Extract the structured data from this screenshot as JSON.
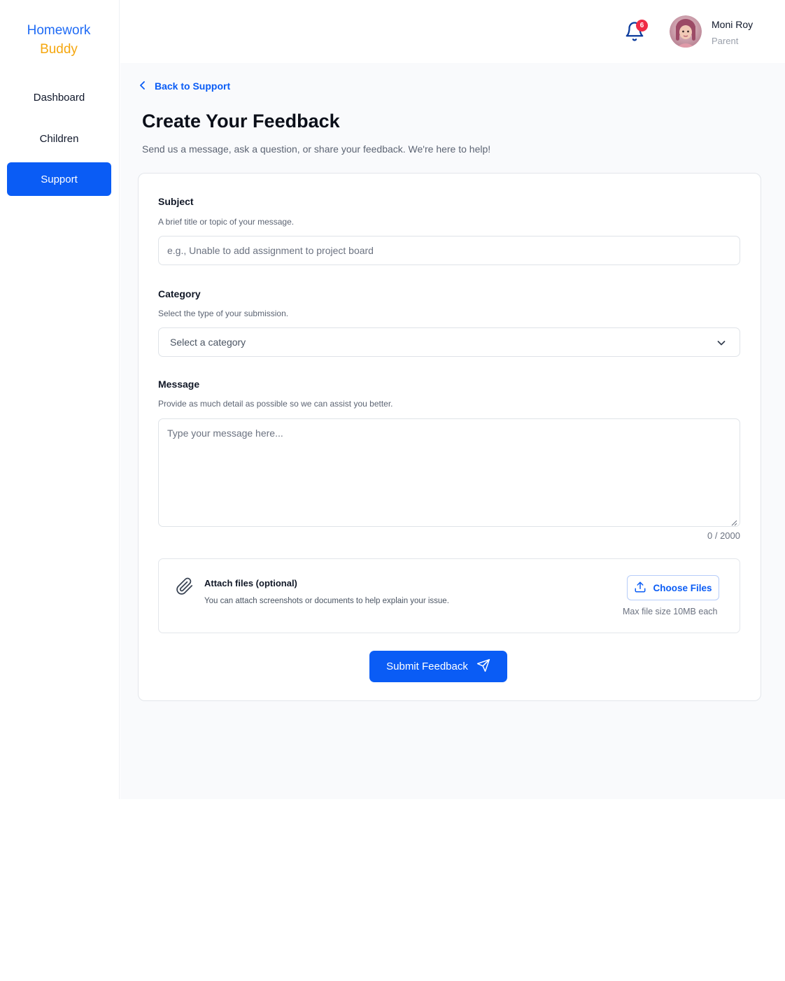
{
  "app": {
    "brand_line1": "Homework",
    "brand_line2": "Buddy",
    "colors": {
      "primary": "#0a5cf5",
      "brand_blue": "#1f6bf5",
      "brand_orange": "#f5a70f",
      "badge_red": "#ef2b45"
    }
  },
  "sidebar": {
    "items": [
      {
        "label": "Dashboard",
        "active": false
      },
      {
        "label": "Children",
        "active": false
      },
      {
        "label": "Support",
        "active": true
      }
    ]
  },
  "header": {
    "notification_count": "6",
    "user_name": "Moni Roy",
    "user_role": "Parent",
    "icons": [
      "bell-icon",
      "avatar"
    ]
  },
  "page": {
    "back_link": "Back to Support",
    "title": "Create Your Feedback",
    "subtitle": "Send us a message, ask a question, or share your feedback. We're here to help!"
  },
  "form": {
    "subject": {
      "label": "Subject",
      "help": "A brief title or topic of your message.",
      "placeholder": "e.g., Unable to add assignment to project board"
    },
    "category": {
      "label": "Category",
      "help": "Select the type of your submission.",
      "selected": "Select a category"
    },
    "message": {
      "label": "Message",
      "help": "Provide as much detail as possible so we can assist you better.",
      "placeholder": "Type your message here...",
      "counter": "0 / 2000"
    },
    "attachments": {
      "title": "Attach files (optional)",
      "help": "You can attach screenshots or documents to help explain your issue.",
      "button": "Choose Files",
      "max_size": "Max file size 10MB each"
    },
    "submit": "Submit Feedback"
  }
}
